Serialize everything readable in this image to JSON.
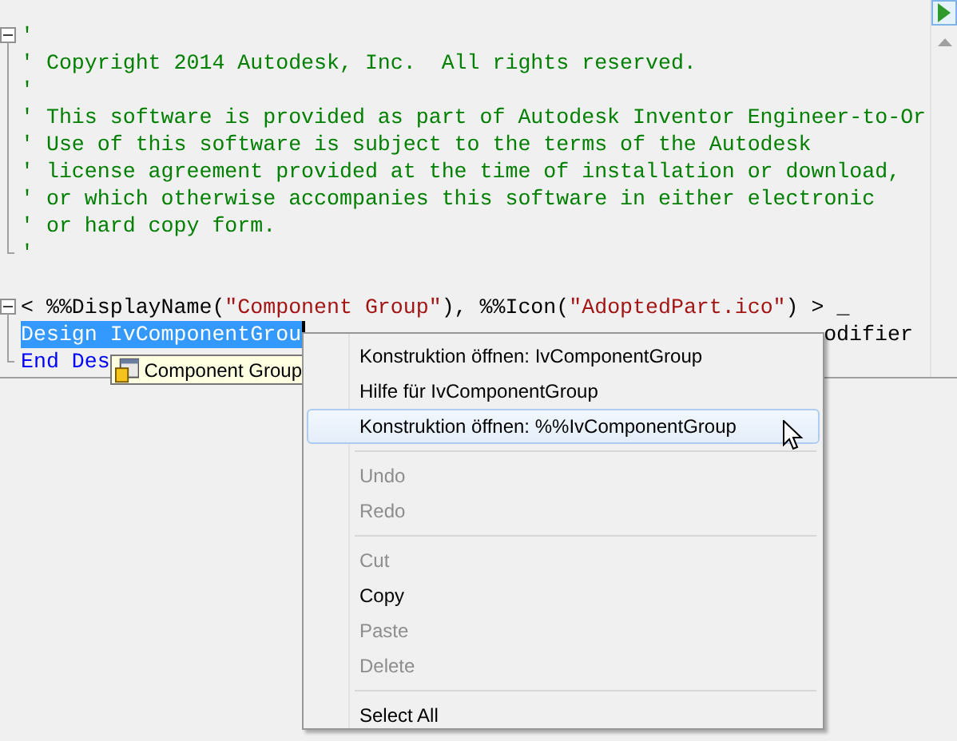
{
  "editor": {
    "blocks": [
      {
        "collapsible": true,
        "lines": [
          {
            "segments": [
              {
                "kind": "comment",
                "text": "'"
              }
            ]
          },
          {
            "segments": [
              {
                "kind": "comment",
                "text": "' Copyright 2014 Autodesk, Inc.  All rights reserved."
              }
            ]
          },
          {
            "segments": [
              {
                "kind": "comment",
                "text": "'"
              }
            ]
          },
          {
            "segments": [
              {
                "kind": "comment",
                "text": "' This software is provided as part of Autodesk Inventor Engineer-to-Or"
              }
            ]
          },
          {
            "segments": [
              {
                "kind": "comment",
                "text": "' Use of this software is subject to the terms of the Autodesk"
              }
            ]
          },
          {
            "segments": [
              {
                "kind": "comment",
                "text": "' license agreement provided at the time of installation or download,"
              }
            ]
          },
          {
            "segments": [
              {
                "kind": "comment",
                "text": "' or which otherwise accompanies this software in either electronic"
              }
            ]
          },
          {
            "segments": [
              {
                "kind": "comment",
                "text": "' or hard copy form."
              }
            ]
          },
          {
            "segments": [
              {
                "kind": "comment",
                "text": "'"
              }
            ]
          }
        ]
      },
      {
        "collapsible": true,
        "lines": [
          {
            "segments": [
              {
                "kind": "plain",
                "text": "< %%DisplayName("
              },
              {
                "kind": "string",
                "text": "\"Component Group\""
              },
              {
                "kind": "plain",
                "text": "), %%Icon("
              },
              {
                "kind": "string",
                "text": "\"AdoptedPart.ico\""
              },
              {
                "kind": "plain",
                "text": ") > _"
              }
            ]
          },
          {
            "caret": true,
            "segments": [
              {
                "kind": "selection",
                "text": "Design IvComponentGrou"
              },
              {
                "kind": "tail",
                "text": "odifier"
              }
            ]
          },
          {
            "segments": [
              {
                "kind": "keyword",
                "text": "End Des"
              }
            ]
          }
        ]
      }
    ]
  },
  "tooltip": {
    "label": "Component Group"
  },
  "context_menu": {
    "items": [
      {
        "kind": "item",
        "label": "Konstruktion öffnen: IvComponentGroup",
        "disabled": false,
        "selected": false
      },
      {
        "kind": "item",
        "label": "Hilfe für IvComponentGroup",
        "disabled": false,
        "selected": false
      },
      {
        "kind": "item",
        "label": "Konstruktion öffnen: %%IvComponentGroup",
        "disabled": false,
        "selected": true
      },
      {
        "kind": "separator"
      },
      {
        "kind": "item",
        "label": "Undo",
        "disabled": true,
        "selected": false
      },
      {
        "kind": "item",
        "label": "Redo",
        "disabled": true,
        "selected": false
      },
      {
        "kind": "separator"
      },
      {
        "kind": "item",
        "label": "Cut",
        "disabled": true,
        "selected": false
      },
      {
        "kind": "item",
        "label": "Copy",
        "disabled": false,
        "selected": false
      },
      {
        "kind": "item",
        "label": "Paste",
        "disabled": true,
        "selected": false
      },
      {
        "kind": "item",
        "label": "Delete",
        "disabled": true,
        "selected": false
      },
      {
        "kind": "separator"
      },
      {
        "kind": "item",
        "label": "Select All",
        "disabled": false,
        "selected": false
      }
    ]
  }
}
